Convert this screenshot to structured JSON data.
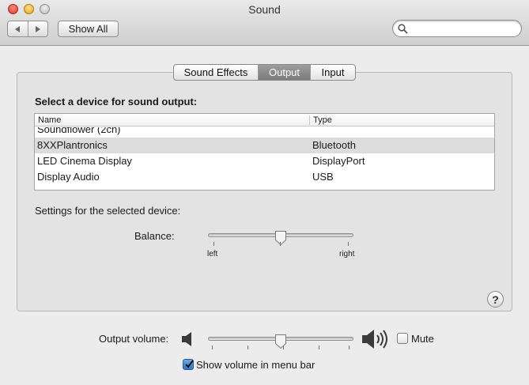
{
  "window": {
    "title": "Sound"
  },
  "toolbar": {
    "back_icon": "back-arrow-icon",
    "forward_icon": "forward-arrow-icon",
    "show_all_label": "Show All",
    "search_placeholder": "",
    "search_value": ""
  },
  "tabs": [
    {
      "label": "Sound Effects",
      "active": false
    },
    {
      "label": "Output",
      "active": true
    },
    {
      "label": "Input",
      "active": false
    }
  ],
  "output": {
    "heading": "Select a device for sound output:",
    "columns": [
      "Name",
      "Type"
    ],
    "rows": [
      {
        "name": "Soundflower (2ch)",
        "type": "",
        "selected": false
      },
      {
        "name": "8XXPlantronics",
        "type": "Bluetooth",
        "selected": true
      },
      {
        "name": "LED Cinema Display",
        "type": "DisplayPort",
        "selected": false
      },
      {
        "name": "Display Audio",
        "type": "USB",
        "selected": false
      }
    ],
    "settings_label": "Settings for the selected device:",
    "balance": {
      "label": "Balance:",
      "left_label": "left",
      "right_label": "right",
      "value": 0.5
    }
  },
  "footer": {
    "output_volume_label": "Output volume:",
    "volume_value": 0.5,
    "mute_label": "Mute",
    "mute_checked": false,
    "show_in_menubar_label": "Show volume in menu bar",
    "show_in_menubar_checked": true
  },
  "colors": {
    "selected_tab": "#8a8a8a",
    "checkbox_accent": "#2d74c9",
    "selected_row": "#dcdcdc"
  }
}
